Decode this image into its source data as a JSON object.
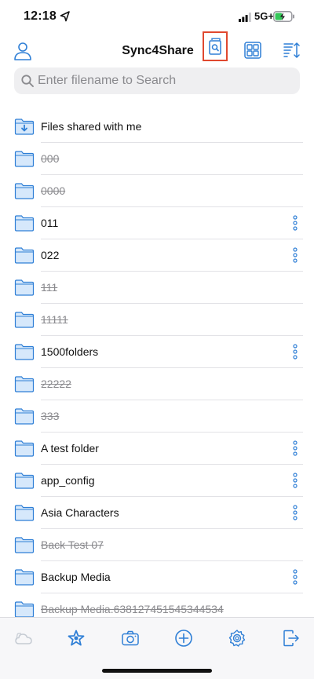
{
  "status_bar": {
    "time": "12:18",
    "network": "5G+"
  },
  "header": {
    "title": "Sync4Share"
  },
  "search": {
    "placeholder": "Enter filename to Search",
    "value": ""
  },
  "colors": {
    "accent": "#2f7fd6",
    "folder_fill": "#d6e8fb",
    "highlight": "#e0482f",
    "deleted_text": "#8a8a8e"
  },
  "files": [
    {
      "name": "Files shared with me",
      "deleted": false,
      "shared": true,
      "has_menu": false
    },
    {
      "name": "000",
      "deleted": true,
      "has_menu": false
    },
    {
      "name": "0000",
      "deleted": true,
      "has_menu": false
    },
    {
      "name": "011",
      "deleted": false,
      "has_menu": true
    },
    {
      "name": "022",
      "deleted": false,
      "has_menu": true
    },
    {
      "name": "111",
      "deleted": true,
      "has_menu": false
    },
    {
      "name": "11111",
      "deleted": true,
      "has_menu": false
    },
    {
      "name": "1500folders",
      "deleted": false,
      "has_menu": true
    },
    {
      "name": "22222",
      "deleted": true,
      "has_menu": false
    },
    {
      "name": "333",
      "deleted": true,
      "has_menu": false
    },
    {
      "name": "A test folder",
      "deleted": false,
      "has_menu": true
    },
    {
      "name": "app_config",
      "deleted": false,
      "has_menu": true
    },
    {
      "name": "Asia Characters",
      "deleted": false,
      "has_menu": true
    },
    {
      "name": "Back Test 07",
      "deleted": true,
      "has_menu": false
    },
    {
      "name": "Backup Media",
      "deleted": false,
      "has_menu": true
    },
    {
      "name": "Backup Media.638127451545344534",
      "deleted": true,
      "has_menu": false
    }
  ],
  "tabbar": {
    "items": [
      {
        "icon": "cloud-icon",
        "active": false,
        "disabled": true
      },
      {
        "icon": "star-icon",
        "active": true,
        "disabled": false
      },
      {
        "icon": "camera-icon",
        "active": false,
        "disabled": false
      },
      {
        "icon": "plus-circle-icon",
        "active": false,
        "disabled": false
      },
      {
        "icon": "gear-icon",
        "active": false,
        "disabled": false
      },
      {
        "icon": "logout-icon",
        "active": false,
        "disabled": false
      }
    ]
  }
}
